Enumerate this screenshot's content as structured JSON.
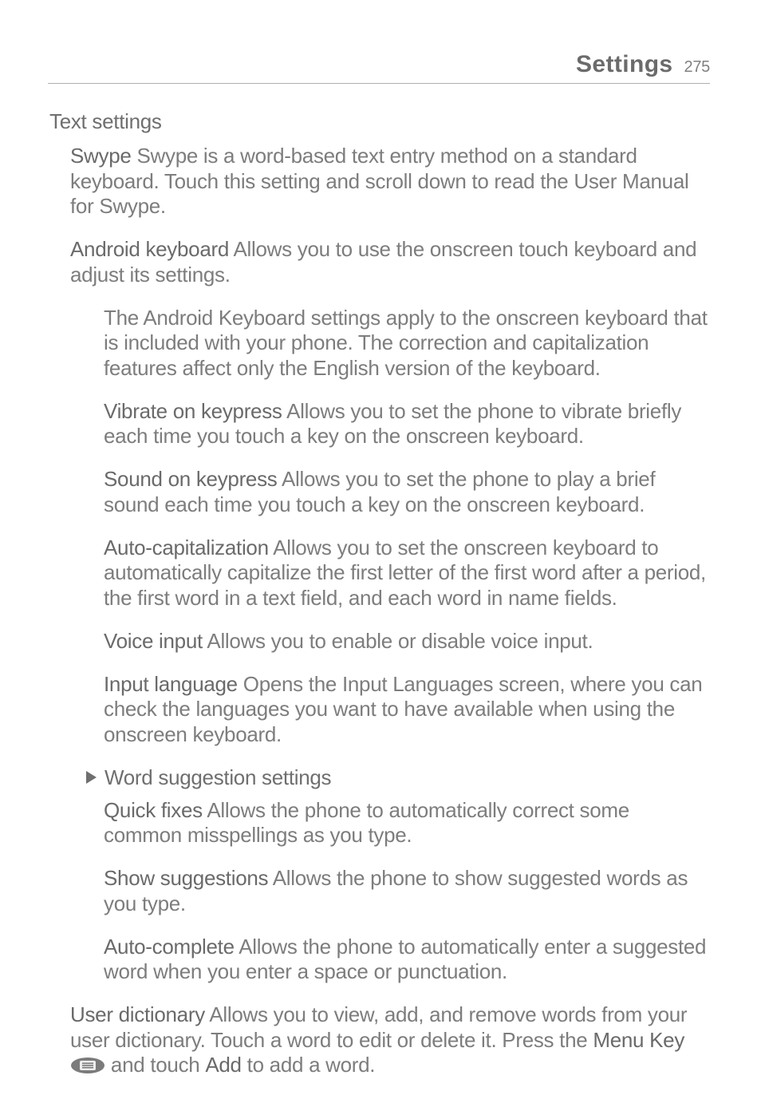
{
  "runhead": {
    "title": "Settings",
    "page": "275"
  },
  "h_text_settings": "Text settings",
  "p_swype": {
    "term": "Swype",
    "body": " Swype is a word-based text entry method on a standard keyboard. Touch this setting and scroll down to read the User Manual for Swype."
  },
  "p_android_kb": {
    "term": "Android keyboard",
    "body": "  Allows you to use the onscreen touch keyboard and adjust its settings."
  },
  "p_android_kb_desc": "The Android Keyboard settings apply to the onscreen keyboard that is included with your phone. The correction and capitalization features affect only the English version of the keyboard.",
  "p_vibrate": {
    "term": "Vibrate on keypress",
    "body": "  Allows you to set the phone to vibrate briefly each time you touch a key on the onscreen keyboard."
  },
  "p_sound": {
    "term": "Sound on keypress",
    "body": "  Allows you to set the phone to play a brief sound each time you touch a key on the onscreen keyboard."
  },
  "p_autocap": {
    "term": "Auto-capitalization",
    "body": "  Allows you to set the onscreen keyboard to automatically capitalize the first letter of the first word after a period, the first word in a text field, and each word in name fields."
  },
  "p_voice": {
    "term": "Voice input",
    "body": "  Allows you to enable or disable voice input."
  },
  "p_inputlang": {
    "term": "Input language",
    "body": "  Opens the Input Languages screen, where you can check the languages you want to have available when using the onscreen keyboard."
  },
  "h_word_suggestion": "Word suggestion settings",
  "p_quickfixes": {
    "term": "Quick fixes",
    "body": "  Allows the phone to automatically correct some common misspellings as you type."
  },
  "p_showsug": {
    "term": "Show suggestions",
    "body": "  Allows the phone to show suggested words as you type."
  },
  "p_autocomplete": {
    "term": "Auto-complete",
    "body": "  Allows the phone to automatically enter a suggested word when you enter a space or punctuation."
  },
  "p_userdict": {
    "term": "User dictionary",
    "seg1": "  Allows you to view, add, and remove words from your user dictionary. Touch a word to edit or delete it. Press the ",
    "menukey": "Menu Key",
    "seg2": " and touch ",
    "add": "Add",
    "seg3": " to add a word."
  }
}
